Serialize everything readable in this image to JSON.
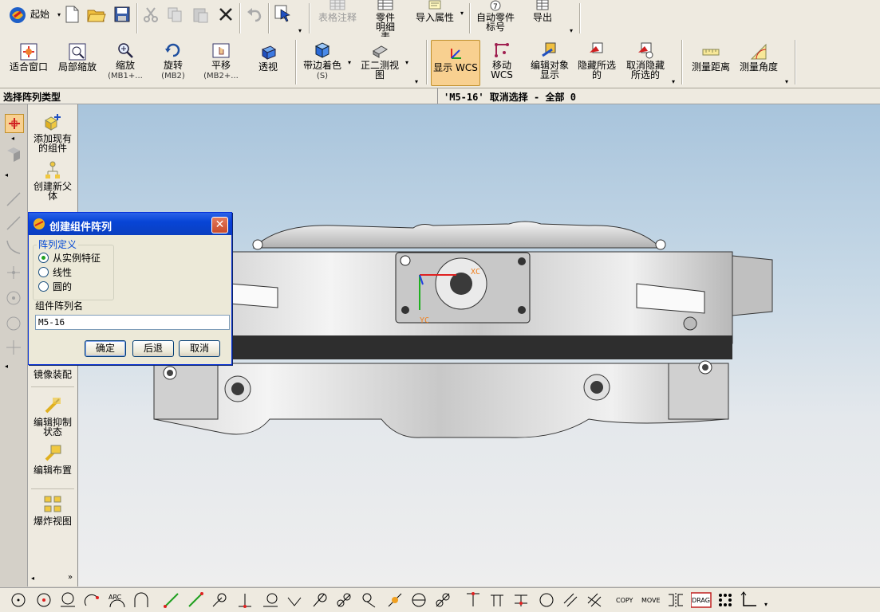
{
  "toolbar1": {
    "start_label": "起始",
    "items": [
      {
        "label": "表格注释",
        "enabled": false
      },
      {
        "label": "零件明细表",
        "enabled": true
      },
      {
        "label": "导入属性",
        "enabled": true
      },
      {
        "label": "自动零件标号",
        "enabled": true
      },
      {
        "label": "导出",
        "enabled": true
      }
    ]
  },
  "toolbar2": {
    "items": [
      {
        "label": "适合窗口",
        "sub": ""
      },
      {
        "label": "局部缩放",
        "sub": ""
      },
      {
        "label": "缩放",
        "sub": "(MB1+..."
      },
      {
        "label": "旋转",
        "sub": "(MB2)"
      },
      {
        "label": "平移",
        "sub": "(MB2+..."
      },
      {
        "label": "透视",
        "sub": ""
      },
      {
        "label": "带边着色",
        "sub": "(S)"
      },
      {
        "label": "正二测视图",
        "sub": ""
      },
      {
        "label": "显示 WCS",
        "sub": ""
      },
      {
        "label": "移动 WCS",
        "sub": ""
      },
      {
        "label": "编辑对象显示",
        "sub": ""
      },
      {
        "label": "隐藏所选的",
        "sub": ""
      },
      {
        "label": "取消隐藏所选的",
        "sub": ""
      },
      {
        "label": "测量距离",
        "sub": ""
      },
      {
        "label": "测量角度",
        "sub": ""
      }
    ]
  },
  "status": {
    "prompt": "选择阵列类型",
    "message": "'M5-16' 取消选择 - 全部 0"
  },
  "resource_bar": {
    "items": [
      {
        "label": "添加现有的组件"
      },
      {
        "label": "创建新父体"
      },
      {
        "label": "镜像装配"
      },
      {
        "label": "编辑抑制状态"
      },
      {
        "label": "编辑布置"
      },
      {
        "label": "爆炸视图"
      }
    ]
  },
  "dialog": {
    "title": "创建组件阵列",
    "group_label": "阵列定义",
    "options": [
      {
        "label": "从实例特征",
        "selected": true
      },
      {
        "label": "线性",
        "selected": false
      },
      {
        "label": "圆的",
        "selected": false
      }
    ],
    "name_label": "组件阵列名",
    "name_value": "M5-16",
    "ok_label": "确定",
    "back_label": "后退",
    "cancel_label": "取消"
  },
  "viewport": {
    "wcs_x_label": "XC",
    "wcs_y_label": "YC"
  },
  "bottom_toolbar": {
    "text_icons": [
      "ARC",
      "COPY",
      "MOVE",
      "DRAG"
    ]
  },
  "colors": {
    "title_bar": "#0845d6",
    "viewport_top": "#a8c4dc",
    "viewport_bottom": "#eeeeee",
    "wcs_highlight": "#f8d090"
  }
}
